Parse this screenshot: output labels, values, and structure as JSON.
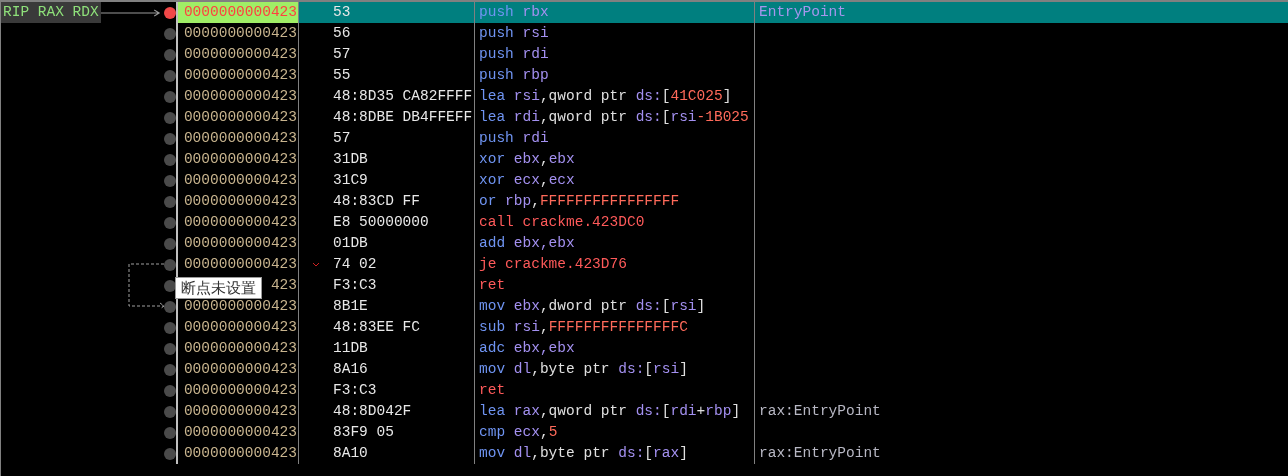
{
  "tooltip": {
    "text": "断点未设置"
  },
  "rows": [
    {
      "address": "0000000000423",
      "bytes": "53",
      "instruction": [
        {
          "text": "push ",
          "kind": "op"
        },
        {
          "text": "rbx",
          "kind": "reg"
        }
      ],
      "comment": "EntryPoint",
      "selected": true,
      "breakpoint": true,
      "registers": "RIP RAX RDX"
    },
    {
      "address": "0000000000423",
      "bytes": "56",
      "instruction": [
        {
          "text": "push ",
          "kind": "op"
        },
        {
          "text": "rsi",
          "kind": "reg"
        }
      ],
      "selected": false,
      "breakpoint": false
    },
    {
      "address": "0000000000423",
      "bytes": "57",
      "instruction": [
        {
          "text": "push ",
          "kind": "op"
        },
        {
          "text": "rdi",
          "kind": "reg"
        }
      ],
      "selected": false,
      "breakpoint": false
    },
    {
      "address": "0000000000423",
      "bytes": "55",
      "instruction": [
        {
          "text": "push ",
          "kind": "op"
        },
        {
          "text": "rbp",
          "kind": "reg"
        }
      ],
      "selected": false,
      "breakpoint": false
    },
    {
      "address": "0000000000423",
      "bytes": "48:8D35 CA82FFFF",
      "instruction": [
        {
          "text": "lea ",
          "kind": "op"
        },
        {
          "text": "rsi",
          "kind": "reg"
        },
        {
          "text": ",qword ptr ",
          "kind": "punct"
        },
        {
          "text": "ds:",
          "kind": "reg"
        },
        {
          "text": "[",
          "kind": "punct"
        },
        {
          "text": "41C025",
          "kind": "num"
        },
        {
          "text": "]",
          "kind": "punct"
        }
      ],
      "selected": false,
      "breakpoint": false
    },
    {
      "address": "0000000000423",
      "bytes": "48:8DBE DB4FFEFF",
      "instruction": [
        {
          "text": "lea ",
          "kind": "op"
        },
        {
          "text": "rdi",
          "kind": "reg"
        },
        {
          "text": ",qword ptr ",
          "kind": "punct"
        },
        {
          "text": "ds:",
          "kind": "reg"
        },
        {
          "text": "[",
          "kind": "punct"
        },
        {
          "text": "rsi",
          "kind": "reg"
        },
        {
          "text": "-1B025",
          "kind": "num"
        }
      ],
      "selected": false,
      "breakpoint": false
    },
    {
      "address": "0000000000423",
      "bytes": "57",
      "instruction": [
        {
          "text": "push ",
          "kind": "op"
        },
        {
          "text": "rdi",
          "kind": "reg"
        }
      ],
      "selected": false,
      "breakpoint": false
    },
    {
      "address": "0000000000423",
      "bytes": "31DB",
      "instruction": [
        {
          "text": "xor ",
          "kind": "op"
        },
        {
          "text": "ebx",
          "kind": "reg"
        },
        {
          "text": ",",
          "kind": "punct"
        },
        {
          "text": "ebx",
          "kind": "reg"
        }
      ],
      "selected": false,
      "breakpoint": false
    },
    {
      "address": "0000000000423",
      "bytes": "31C9",
      "instruction": [
        {
          "text": "xor ",
          "kind": "op"
        },
        {
          "text": "ecx",
          "kind": "reg"
        },
        {
          "text": ",",
          "kind": "punct"
        },
        {
          "text": "ecx",
          "kind": "reg"
        }
      ],
      "selected": false,
      "breakpoint": false
    },
    {
      "address": "0000000000423",
      "bytes": "48:83CD FF",
      "instruction": [
        {
          "text": "or ",
          "kind": "op"
        },
        {
          "text": "rbp",
          "kind": "reg"
        },
        {
          "text": ",",
          "kind": "punct"
        },
        {
          "text": "FFFFFFFFFFFFFFFF",
          "kind": "num"
        }
      ],
      "selected": false,
      "breakpoint": false
    },
    {
      "address": "0000000000423",
      "bytes": "E8 50000000",
      "instruction": [
        {
          "text": "call crackme.423DC0",
          "kind": "flow"
        }
      ],
      "selected": false,
      "breakpoint": false
    },
    {
      "address": "0000000000423",
      "bytes": "01DB",
      "instruction": [
        {
          "text": "add ",
          "kind": "op"
        },
        {
          "text": "ebx,ebx",
          "kind": "reg"
        }
      ],
      "selected": false,
      "breakpoint": false
    },
    {
      "address": "0000000000423",
      "bytes": "74 02",
      "instruction": [
        {
          "text": "je crackme.423D76",
          "kind": "flow"
        }
      ],
      "selected": false,
      "breakpoint": false,
      "jump_source": true
    },
    {
      "address": "423",
      "bytes": "F3:C3",
      "instruction": [
        {
          "text": "ret",
          "kind": "flow"
        }
      ],
      "selected": false,
      "breakpoint": false
    },
    {
      "address": "0000000000423",
      "bytes": "8B1E",
      "instruction": [
        {
          "text": "mov ",
          "kind": "op"
        },
        {
          "text": "ebx",
          "kind": "reg"
        },
        {
          "text": ",dword ptr ",
          "kind": "punct"
        },
        {
          "text": "ds:",
          "kind": "reg"
        },
        {
          "text": "[",
          "kind": "punct"
        },
        {
          "text": "rsi",
          "kind": "reg"
        },
        {
          "text": "]",
          "kind": "punct"
        }
      ],
      "selected": false,
      "breakpoint": false,
      "jump_target": true
    },
    {
      "address": "0000000000423",
      "bytes": "48:83EE FC",
      "instruction": [
        {
          "text": "sub ",
          "kind": "op"
        },
        {
          "text": "rsi",
          "kind": "reg"
        },
        {
          "text": ",",
          "kind": "punct"
        },
        {
          "text": "FFFFFFFFFFFFFFFC",
          "kind": "num"
        }
      ],
      "selected": false,
      "breakpoint": false
    },
    {
      "address": "0000000000423",
      "bytes": "11DB",
      "instruction": [
        {
          "text": "adc ",
          "kind": "op"
        },
        {
          "text": "ebx,ebx",
          "kind": "reg"
        }
      ],
      "selected": false,
      "breakpoint": false
    },
    {
      "address": "0000000000423",
      "bytes": "8A16",
      "instruction": [
        {
          "text": "mov ",
          "kind": "op"
        },
        {
          "text": "dl",
          "kind": "reg"
        },
        {
          "text": ",byte ptr ",
          "kind": "punct"
        },
        {
          "text": "ds:",
          "kind": "reg"
        },
        {
          "text": "[",
          "kind": "punct"
        },
        {
          "text": "rsi",
          "kind": "reg"
        },
        {
          "text": "]",
          "kind": "punct"
        }
      ],
      "selected": false,
      "breakpoint": false
    },
    {
      "address": "0000000000423",
      "bytes": "F3:C3",
      "instruction": [
        {
          "text": "ret",
          "kind": "flow"
        }
      ],
      "selected": false,
      "breakpoint": false
    },
    {
      "address": "0000000000423",
      "bytes": "48:8D042F",
      "instruction": [
        {
          "text": "lea ",
          "kind": "op"
        },
        {
          "text": "rax",
          "kind": "reg"
        },
        {
          "text": ",qword ptr ",
          "kind": "punct"
        },
        {
          "text": "ds:",
          "kind": "reg"
        },
        {
          "text": "[",
          "kind": "punct"
        },
        {
          "text": "rdi",
          "kind": "reg"
        },
        {
          "text": "+",
          "kind": "punct"
        },
        {
          "text": "rbp",
          "kind": "reg"
        },
        {
          "text": "]",
          "kind": "punct"
        }
      ],
      "comment": "rax:EntryPoint",
      "selected": false,
      "breakpoint": false
    },
    {
      "address": "0000000000423",
      "bytes": "83F9 05",
      "instruction": [
        {
          "text": "cmp ",
          "kind": "op"
        },
        {
          "text": "ecx",
          "kind": "reg"
        },
        {
          "text": ",",
          "kind": "punct"
        },
        {
          "text": "5",
          "kind": "num"
        }
      ],
      "selected": false,
      "breakpoint": false
    },
    {
      "address": "0000000000423",
      "bytes": "8A10",
      "instruction": [
        {
          "text": "mov ",
          "kind": "op"
        },
        {
          "text": "dl",
          "kind": "reg"
        },
        {
          "text": ",byte ptr ",
          "kind": "punct"
        },
        {
          "text": "ds:",
          "kind": "reg"
        },
        {
          "text": "[",
          "kind": "punct"
        },
        {
          "text": "rax",
          "kind": "reg"
        },
        {
          "text": "]",
          "kind": "punct"
        }
      ],
      "comment": "rax:EntryPoint",
      "selected": false,
      "breakpoint": false
    }
  ]
}
